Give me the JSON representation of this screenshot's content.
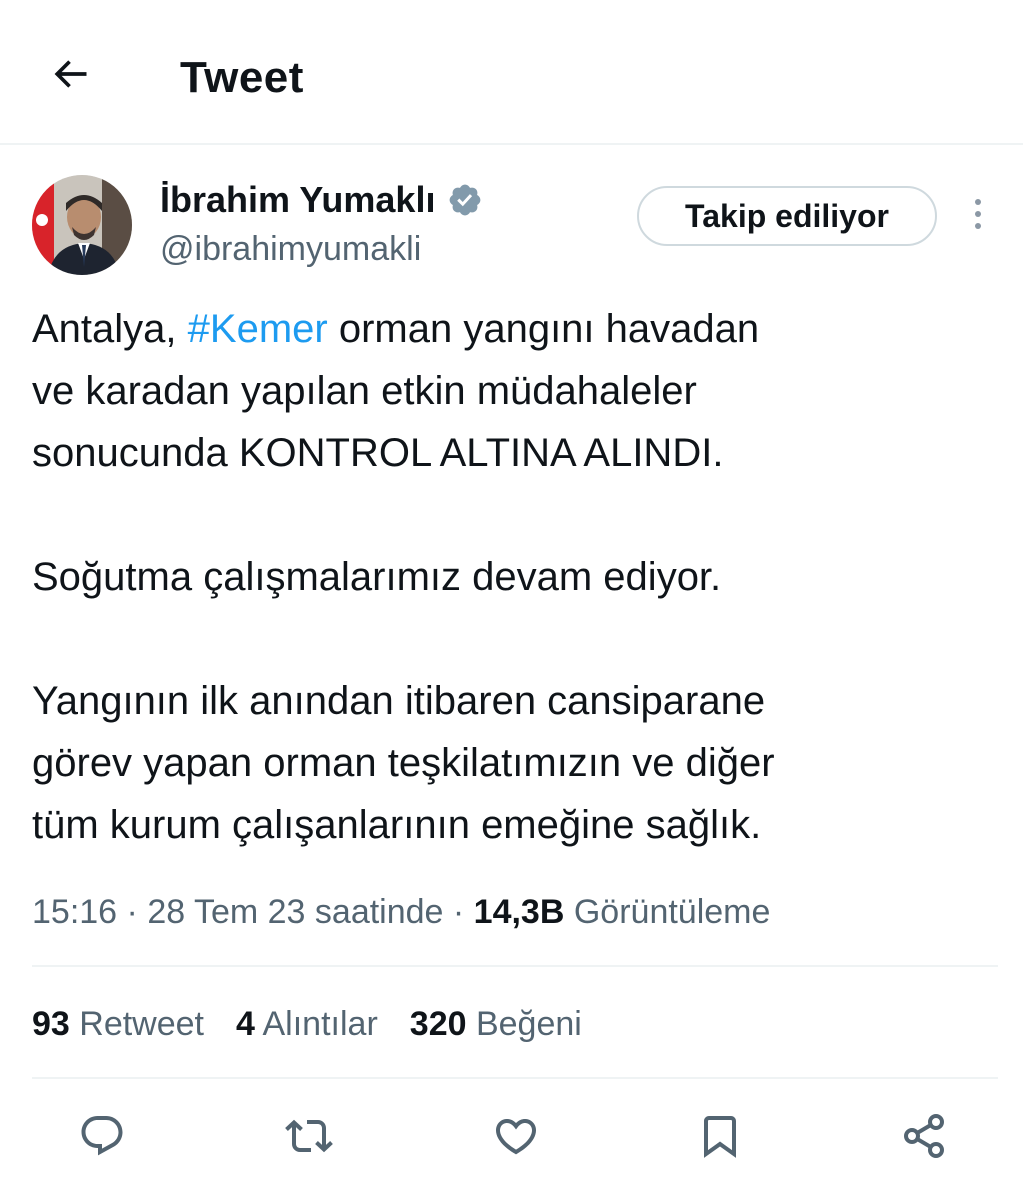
{
  "header": {
    "title": "Tweet"
  },
  "author": {
    "name": "İbrahim Yumaklı",
    "handle": "@ibrahimyumakli",
    "follow_label": "Takip ediliyor"
  },
  "tweet": {
    "line1_pre": "Antalya, ",
    "hashtag": "#Kemer",
    "line1_post": " orman yangını havadan",
    "line2": "ve karadan yapılan etkin müdahaleler",
    "line3": "sonucunda KONTROL ALTINA ALINDI.",
    "line4": "Soğutma çalışmalarımız devam ediyor.",
    "line5": "Yangının ilk anından itibaren cansiparane",
    "line6": "görev yapan orman teşkilatımızın ve diğer",
    "line7": "tüm kurum çalışanlarının emeğine sağlık."
  },
  "meta": {
    "time": "15:16",
    "sep1": " · ",
    "date": "28 Tem 23 saatinde",
    "sep2": " · ",
    "views_count": "14,3B",
    "views_label": " Görüntüleme"
  },
  "stats": {
    "retweets_count": "93",
    "retweets_label": " Retweet",
    "quotes_count": "4",
    "quotes_label": " Alıntılar",
    "likes_count": "320",
    "likes_label": " Beğeni"
  },
  "icons": {
    "back": "arrow-left-icon",
    "verified": "verified-badge-icon",
    "more": "more-vertical-icon",
    "reply": "reply-icon",
    "retweet": "retweet-icon",
    "like": "heart-icon",
    "bookmark": "bookmark-icon",
    "share": "share-icon"
  },
  "colors": {
    "accent": "#1d9bf0",
    "text": "#0f1419",
    "secondary": "#536471",
    "divider": "#eff3f4",
    "verified": "#829aab"
  }
}
